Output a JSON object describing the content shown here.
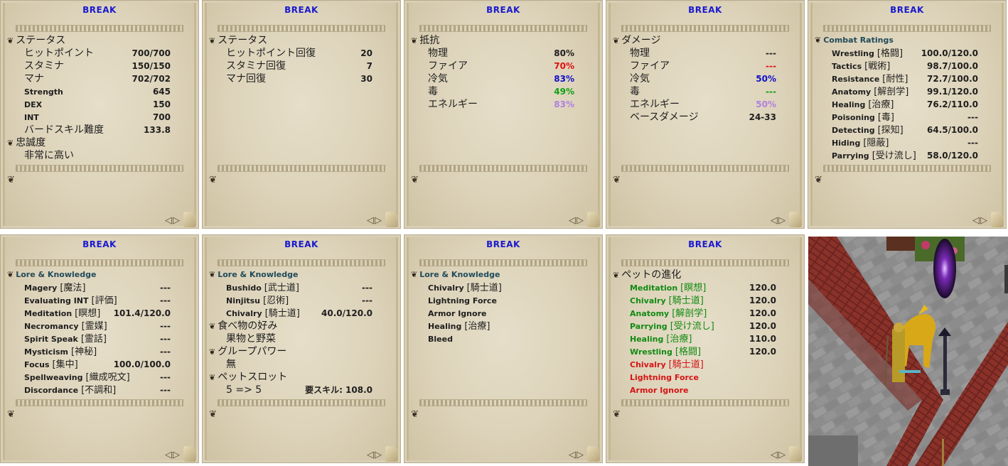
{
  "panels": [
    {
      "title": "BREAK",
      "sections": [
        {
          "header": "ステータス",
          "eng": false,
          "rows": [
            {
              "label": "ヒットポイント",
              "value": "700/700"
            },
            {
              "label": "スタミナ",
              "value": "150/150"
            },
            {
              "label": "マナ",
              "value": "702/702"
            },
            {
              "label": "Strength",
              "value": "645",
              "eng": true
            },
            {
              "label": "DEX",
              "value": "150",
              "eng": true
            },
            {
              "label": "INT",
              "value": "700",
              "eng": true
            },
            {
              "label": "バードスキル難度",
              "value": "133.8"
            }
          ]
        },
        {
          "header": "忠誠度",
          "eng": false,
          "rows": [
            {
              "label": "非常に高い",
              "value": ""
            }
          ]
        }
      ]
    },
    {
      "title": "BREAK",
      "sections": [
        {
          "header": "ステータス",
          "eng": false,
          "rows": [
            {
              "label": "ヒットポイント回復",
              "value": "20"
            },
            {
              "label": "スタミナ回復",
              "value": "7"
            },
            {
              "label": "マナ回復",
              "value": "30"
            }
          ]
        }
      ]
    },
    {
      "title": "BREAK",
      "sections": [
        {
          "header": "抵抗",
          "eng": false,
          "rows": [
            {
              "label": "物理",
              "value": "80%",
              "color": "#1e1e1e"
            },
            {
              "label": "ファイア",
              "value": "70%",
              "color": "#e01010"
            },
            {
              "label": "冷気",
              "value": "83%",
              "color": "#1010c8"
            },
            {
              "label": "毒",
              "value": "49%",
              "color": "#10a010"
            },
            {
              "label": "エネルギー",
              "value": "83%",
              "color": "#b080e0"
            }
          ]
        }
      ]
    },
    {
      "title": "BREAK",
      "sections": [
        {
          "header": "ダメージ",
          "eng": false,
          "rows": [
            {
              "label": "物理",
              "value": "---",
              "color": "#1e1e1e"
            },
            {
              "label": "ファイア",
              "value": "---",
              "color": "#e01010"
            },
            {
              "label": "冷気",
              "value": "50%",
              "color": "#1010c8"
            },
            {
              "label": "毒",
              "value": "---",
              "color": "#10a010"
            },
            {
              "label": "エネルギー",
              "value": "50%",
              "color": "#b080e0"
            },
            {
              "label": "ベースダメージ",
              "value": "24-33"
            }
          ]
        }
      ]
    },
    {
      "title": "BREAK",
      "sections": [
        {
          "header": "Combat Ratings",
          "eng": true,
          "rows": [
            {
              "label": "Wrestling",
              "jp": "[格闘]",
              "value": "100.0/120.0",
              "eng": true
            },
            {
              "label": "Tactics",
              "jp": "[戦術]",
              "value": "98.7/100.0",
              "eng": true
            },
            {
              "label": "Resistance",
              "jp": "[耐性]",
              "value": "72.7/100.0",
              "eng": true
            },
            {
              "label": "Anatomy",
              "jp": "[解剖学]",
              "value": "99.1/120.0",
              "eng": true
            },
            {
              "label": "Healing",
              "jp": "[治療]",
              "value": "76.2/110.0",
              "eng": true
            },
            {
              "label": "Poisoning",
              "jp": "[毒]",
              "value": "---",
              "eng": true
            },
            {
              "label": "Detecting",
              "jp": "[探知]",
              "value": "64.5/100.0",
              "eng": true
            },
            {
              "label": "Hiding",
              "jp": "[隠蔽]",
              "value": "---",
              "eng": true
            },
            {
              "label": "Parrying",
              "jp": "[受け流し]",
              "value": "58.0/120.0",
              "eng": true
            }
          ]
        }
      ]
    },
    {
      "title": "BREAK",
      "sections": [
        {
          "header": "Lore & Knowledge",
          "eng": true,
          "rows": [
            {
              "label": "Magery",
              "jp": "[魔法]",
              "value": "---",
              "eng": true
            },
            {
              "label": "Evaluating INT",
              "jp": "[評価]",
              "value": "---",
              "eng": true
            },
            {
              "label": "Meditation",
              "jp": "[瞑想]",
              "value": "101.4/120.0",
              "eng": true
            },
            {
              "label": "Necromancy",
              "jp": "[霊媒]",
              "value": "---",
              "eng": true
            },
            {
              "label": "Spirit Speak",
              "jp": "[霊話]",
              "value": "---",
              "eng": true
            },
            {
              "label": "Mysticism",
              "jp": "[神秘]",
              "value": "---",
              "eng": true
            },
            {
              "label": "Focus",
              "jp": "[集中]",
              "value": "100.0/100.0",
              "eng": true
            },
            {
              "label": "Spellweaving",
              "jp": "[織成呪文]",
              "value": "---",
              "eng": true
            },
            {
              "label": "Discordance",
              "jp": "[不調和]",
              "value": "---",
              "eng": true
            }
          ]
        }
      ]
    },
    {
      "title": "BREAK",
      "sections": [
        {
          "header": "Lore & Knowledge",
          "eng": true,
          "rows": [
            {
              "label": "Bushido",
              "jp": "[武士道]",
              "value": "---",
              "eng": true
            },
            {
              "label": "Ninjitsu",
              "jp": "[忍術]",
              "value": "---",
              "eng": true
            },
            {
              "label": "Chivalry",
              "jp": "[騎士道]",
              "value": "40.0/120.0",
              "eng": true
            }
          ]
        },
        {
          "header": "食べ物の好み",
          "eng": false,
          "rows": [
            {
              "label": "果物と野菜",
              "value": ""
            }
          ]
        },
        {
          "header": "グループパワー",
          "eng": false,
          "rows": [
            {
              "label": "無",
              "value": ""
            }
          ]
        },
        {
          "header": "ペットスロット",
          "eng": false,
          "rows": [
            {
              "label": "5 => 5",
              "value": "要スキル: 108.0"
            }
          ]
        }
      ]
    },
    {
      "title": "BREAK",
      "sections": [
        {
          "header": "Lore & Knowledge",
          "eng": true,
          "rows": [
            {
              "label": "Chivalry",
              "jp": "[騎士道]",
              "value": "",
              "eng": true
            },
            {
              "label": "Lightning Force",
              "value": "",
              "eng": true
            },
            {
              "label": "Armor Ignore",
              "value": "",
              "eng": true
            },
            {
              "label": "Healing",
              "jp": "[治療]",
              "value": "",
              "eng": true
            },
            {
              "label": "Bleed",
              "value": "",
              "eng": true
            }
          ]
        }
      ]
    },
    {
      "title": "BREAK",
      "sections": [
        {
          "header": "ペットの進化",
          "eng": false,
          "rows": [
            {
              "label": "Meditation",
              "jp": "[瞑想]",
              "value": "120.0",
              "eng": true,
              "lcolor": "#128a12"
            },
            {
              "label": "Chivalry",
              "jp": "[騎士道]",
              "value": "120.0",
              "eng": true,
              "lcolor": "#128a12"
            },
            {
              "label": "Anatomy",
              "jp": "[解剖学]",
              "value": "120.0",
              "eng": true,
              "lcolor": "#128a12"
            },
            {
              "label": "Parrying",
              "jp": "[受け流し]",
              "value": "120.0",
              "eng": true,
              "lcolor": "#128a12"
            },
            {
              "label": "Healing",
              "jp": "[治療]",
              "value": "110.0",
              "eng": true,
              "lcolor": "#128a12"
            },
            {
              "label": "Wrestling",
              "jp": "[格闘]",
              "value": "120.0",
              "eng": true,
              "lcolor": "#128a12"
            },
            {
              "label": "Chivalry",
              "jp": "[騎士道]",
              "value": "",
              "eng": true,
              "lcolor": "#d41414"
            },
            {
              "label": "Lightning Force",
              "value": "",
              "eng": true,
              "lcolor": "#d41414"
            },
            {
              "label": "Armor Ignore",
              "value": "",
              "eng": true,
              "lcolor": "#d41414"
            }
          ]
        }
      ]
    }
  ],
  "icons": {
    "hook": "❦",
    "prev": "◁",
    "next": "▷"
  }
}
